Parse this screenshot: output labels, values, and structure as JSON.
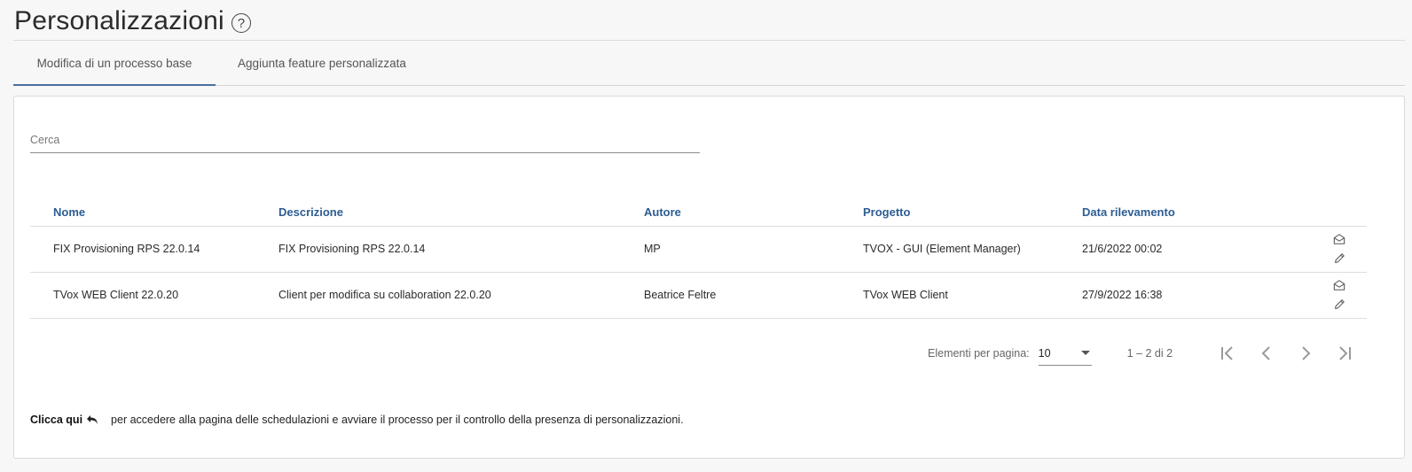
{
  "page": {
    "title": "Personalizzazioni",
    "help_icon": "question-circle-icon"
  },
  "tabs": [
    {
      "label": "Modifica di un processo base",
      "active": true
    },
    {
      "label": "Aggiunta feature personalizzata",
      "active": false
    }
  ],
  "search": {
    "placeholder": "Cerca",
    "value": ""
  },
  "table": {
    "columns": [
      "Nome",
      "Descrizione",
      "Autore",
      "Progetto",
      "Data rilevamento"
    ],
    "rows": [
      {
        "nome": "FIX Provisioning RPS 22.0.14",
        "descrizione": "FIX Provisioning RPS 22.0.14",
        "autore": "MP",
        "progetto": "TVOX - GUI (Element Manager)",
        "data": "21/6/2022 00:02"
      },
      {
        "nome": "TVox WEB Client 22.0.20",
        "descrizione": "Client per modifica su collaboration 22.0.20",
        "autore": "Beatrice Feltre",
        "progetto": "TVox WEB Client",
        "data": "27/9/2022 16:38"
      }
    ],
    "row_actions": [
      "envelope-open-icon",
      "pencil-icon"
    ]
  },
  "paginator": {
    "page_size_label": "Elementi per pagina:",
    "page_size": "10",
    "range_label": "1 – 2 di 2"
  },
  "footer": {
    "link_label": "Clicca qui",
    "link_icon": "reply-arrow-icon",
    "text": "per accedere alla pagina delle schedulazioni e avviare il processo per il controllo della presenza di personalizzazioni."
  },
  "colors": {
    "accent": "#2d5d92",
    "tab_indicator": "#4a6fa0"
  }
}
